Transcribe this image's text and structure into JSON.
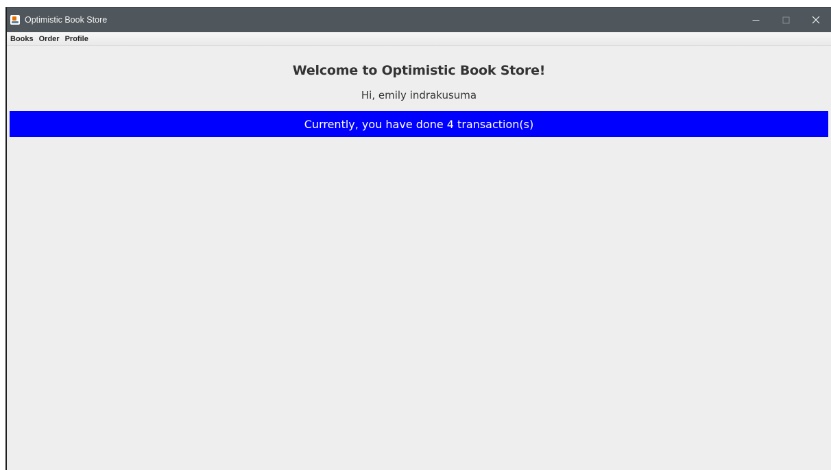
{
  "window": {
    "title": "Optimistic Book Store",
    "icon": "java-cup-icon",
    "controls": [
      "minimize-icon",
      "maximize-icon",
      "close-icon"
    ]
  },
  "menu": {
    "items": [
      {
        "label": "Books"
      },
      {
        "label": "Order"
      },
      {
        "label": "Profile"
      }
    ]
  },
  "main": {
    "heading": "Welcome to Optimistic Book Store!",
    "greeting": "Hi, emily indrakusuma",
    "banner": "Currently, you have done 4 transaction(s)"
  },
  "colors": {
    "titlebar": "#4f575c",
    "background": "#eeeeee",
    "banner": "#0000ff",
    "banner_text": "#ffffff"
  }
}
